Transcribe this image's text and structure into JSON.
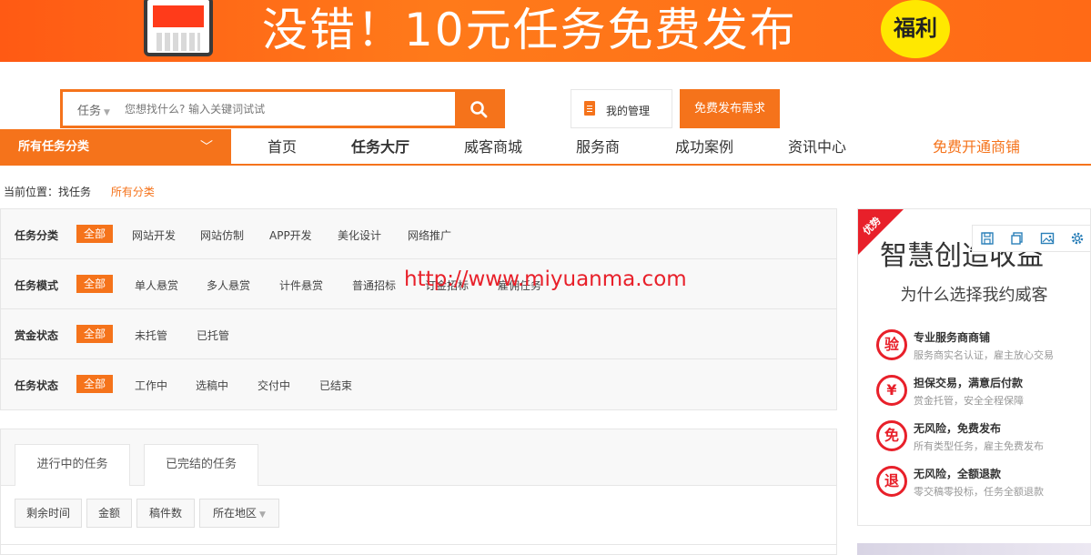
{
  "banner": {
    "text": "没错！10元任务免费发布",
    "badge": "福利"
  },
  "search": {
    "category": "任务",
    "placeholder": "您想找什么? 输入关键词试试"
  },
  "header": {
    "manage_label": "我的管理",
    "publish_label": "免费发布需求"
  },
  "nav": {
    "category_label": "所有任务分类",
    "items": [
      "首页",
      "任务大厅",
      "威客商城",
      "服务商",
      "成功案例",
      "资讯中心",
      "免费开通商铺"
    ]
  },
  "breadcrumb": {
    "prefix": "当前位置：找任务",
    "current": "所有分类"
  },
  "filters": [
    {
      "label": "任务分类",
      "all": "全部",
      "options": [
        "网站开发",
        "网站仿制",
        "APP开发",
        "美化设计",
        "网络推广"
      ]
    },
    {
      "label": "任务模式",
      "all": "全部",
      "options": [
        "单人悬赏",
        "多人悬赏",
        "计件悬赏",
        "普通招标",
        "订金招标",
        "雇佣任务"
      ]
    },
    {
      "label": "赏金状态",
      "all": "全部",
      "options": [
        "未托管",
        "已托管"
      ]
    },
    {
      "label": "任务状态",
      "all": "全部",
      "options": [
        "工作中",
        "选稿中",
        "交付中",
        "已结束"
      ]
    }
  ],
  "watermark": "http://www.miyuanma.com",
  "tasks": {
    "tabs": [
      "进行中的任务",
      "已完结的任务"
    ],
    "sorts": [
      "剩余时间",
      "金额",
      "稿件数",
      "所在地区"
    ]
  },
  "sidebar": {
    "ribbon": "优势",
    "title": "智慧创造收益",
    "subtitle": "为什么选择我约威客",
    "advantages": [
      {
        "icon": "验",
        "title": "专业服务商商铺",
        "desc": "服务商实名认证，雇主放心交易"
      },
      {
        "icon": "¥",
        "title": "担保交易，满意后付款",
        "desc": "赏金托管，安全全程保障"
      },
      {
        "icon": "免",
        "title": "无风险，免费发布",
        "desc": "所有类型任务，雇主免费发布"
      },
      {
        "icon": "退",
        "title": "无风险，全额退款",
        "desc": "零交稿零投标，任务全额退款"
      }
    ]
  },
  "colors": {
    "accent": "#f5731b",
    "red": "#e8202a"
  },
  "icons": [
    "search-icon",
    "document-icon",
    "chevron-down-icon",
    "save-icon",
    "copy-icon",
    "image-icon",
    "gear-icon"
  ]
}
